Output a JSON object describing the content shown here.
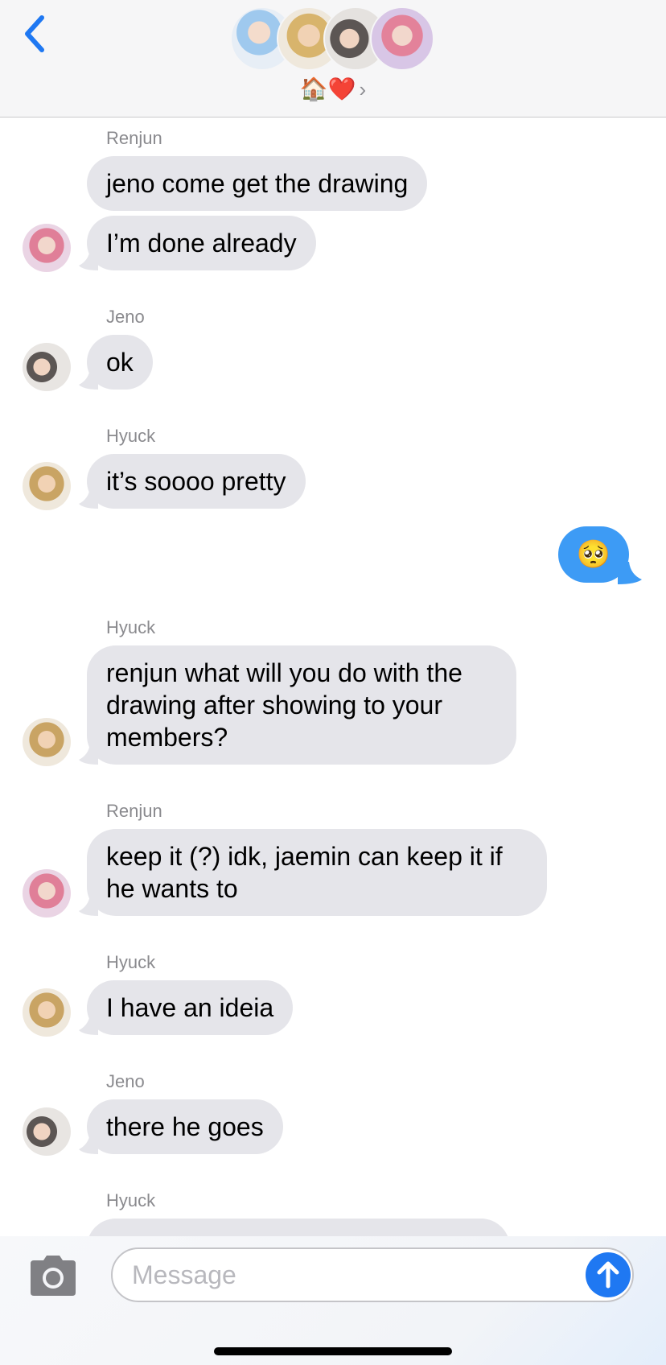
{
  "header": {
    "group_name": "🏠❤️",
    "chevron": "›"
  },
  "messages": [
    {
      "sender": "Renjun",
      "bubbles": [
        "jeno come get the drawing",
        "I’m done already"
      ],
      "avatar": "renjun"
    },
    {
      "sender": "Jeno",
      "bubbles": [
        "ok"
      ],
      "avatar": "jeno"
    },
    {
      "sender": "Hyuck",
      "bubbles": [
        "it’s soooo pretty"
      ],
      "avatar": "hyuck"
    },
    {
      "sender": "",
      "outgoing": true,
      "bubbles": [
        "🥺"
      ]
    },
    {
      "sender": "Hyuck",
      "bubbles": [
        "renjun what will you do with the drawing after showing to your members?"
      ],
      "avatar": "hyuck"
    },
    {
      "sender": "Renjun",
      "bubbles": [
        "keep it (?) idk, jaemin can keep it if he wants to"
      ],
      "avatar": "renjun"
    },
    {
      "sender": "Hyuck",
      "bubbles": [
        "I have an ideia"
      ],
      "avatar": "hyuck"
    },
    {
      "sender": "Jeno",
      "bubbles": [
        "there he goes"
      ],
      "avatar": "jeno"
    },
    {
      "sender": "Hyuck",
      "bubbles": [],
      "avatar": "hyuck"
    }
  ],
  "composer": {
    "placeholder": "Message"
  },
  "colors": {
    "incoming_bubble": "#e5e5ea",
    "outgoing_bubble": "#3d9bf5",
    "accent": "#1f78f2",
    "sender_label": "#8a8a8e"
  },
  "icons": [
    "back-chevron-icon",
    "camera-icon",
    "send-arrow-icon"
  ]
}
